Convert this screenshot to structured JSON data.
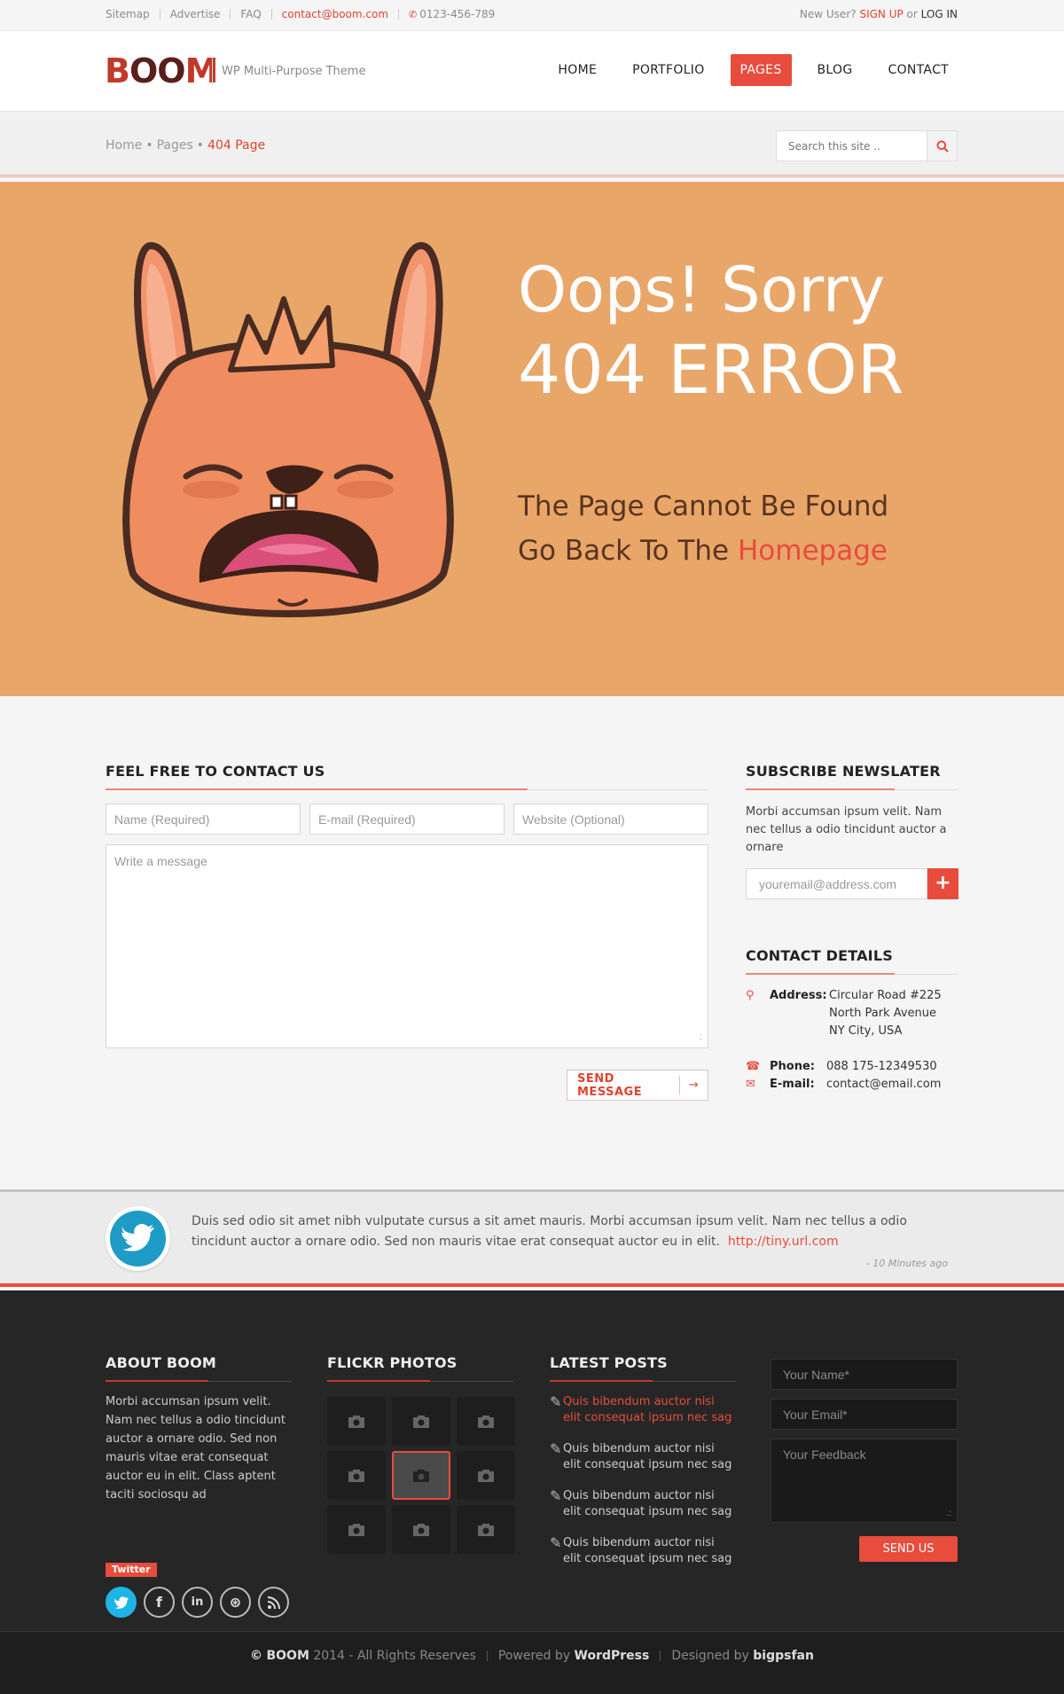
{
  "topbar": {
    "links": [
      "Sitemap",
      "Advertise",
      "FAQ"
    ],
    "email": "contact@boom.com",
    "phone": "0123-456-789",
    "new_user": "New User?",
    "signup": "SIGN UP",
    "or": "or",
    "login": "LOG IN"
  },
  "header": {
    "logo_b": "B",
    "logo_oo": "OO",
    "logo_m": "M",
    "tagline": "WP Multi-Purpose Theme",
    "nav": [
      "HOME",
      "PORTFOLIO",
      "PAGES",
      "BLOG",
      "CONTACT"
    ],
    "active_nav": "PAGES"
  },
  "breadcrumb": {
    "items": [
      "Home",
      "Pages"
    ],
    "current": "404 Page",
    "search_placeholder": "Search this site .."
  },
  "hero": {
    "title_line1": "Oops! Sorry",
    "title_line2": "404 ERROR",
    "sub_line1": "The Page Cannot Be Found",
    "sub_line2_prefix": "Go Back To The",
    "sub_line2_link": "Homepage",
    "colors": {
      "background": "#e8a669",
      "accent": "#e74c3c"
    }
  },
  "contact": {
    "title": "FEEL FREE TO CONTACT US",
    "name_placeholder": "Name (Required)",
    "email_placeholder": "E-mail (Required)",
    "website_placeholder": "Website (Optional)",
    "message_placeholder": "Write a message",
    "send": "SEND MESSAGE"
  },
  "newsletter": {
    "title": "SUBSCRIBE NEWSLATER",
    "text": "Morbi accumsan ipsum velit. Nam nec tellus a odio tincidunt auctor a ornare",
    "placeholder": "youremail@address.com"
  },
  "contact_details": {
    "title": "CONTACT DETAILS",
    "address_label": "Address:",
    "address_lines": [
      "Circular Road #225",
      "North Park Avenue",
      "NY City, USA"
    ],
    "phone_label": "Phone:",
    "phone": "088 175-12349530",
    "email_label": "E-mail:",
    "email": "contact@email.com"
  },
  "tweet": {
    "text": "Duis sed odio sit amet nibh vulputate cursus a sit amet mauris. Morbi accumsan ipsum velit. Nam nec tellus a odio tincidunt auctor a ornare odio. Sed non  mauris vitae erat consequat auctor eu in elit.",
    "link": "http://tiny.url.com",
    "time": "- 10 Minutes ago"
  },
  "footer": {
    "about_title_prefix": "ABOUT",
    "about_title_brand": "BOOM",
    "about_text": "Morbi accumsan ipsum velit. Nam nec tellus a odio tincidunt auctor a ornare odio. Sed non  mauris vitae erat consequat auctor eu in elit. Class aptent taciti sociosqu ad",
    "twitter_tag": "Twitter",
    "flickr_title": "FLICKR PHOTOS",
    "posts_title": "LATEST POSTS",
    "posts": [
      "Quis bibendum auctor nisi elit consequat ipsum nec sag",
      "Quis bibendum auctor nisi elit consequat ipsum nec sag",
      "Quis bibendum auctor nisi elit consequat ipsum nec sag",
      "Quis bibendum auctor nisi elit consequat ipsum nec sag"
    ],
    "form_name": "Your Name*",
    "form_email": "Your Email*",
    "form_feedback": "Your Feedback",
    "form_send": "SEND US"
  },
  "bottombar": {
    "copyright_sym": "©",
    "brand": "BOOM",
    "copyright": "2014 - All Rights Reserves",
    "powered_prefix": "Powered by",
    "powered": "WordPress",
    "designed_prefix": "Designed by",
    "designer": "bigpsfan"
  }
}
